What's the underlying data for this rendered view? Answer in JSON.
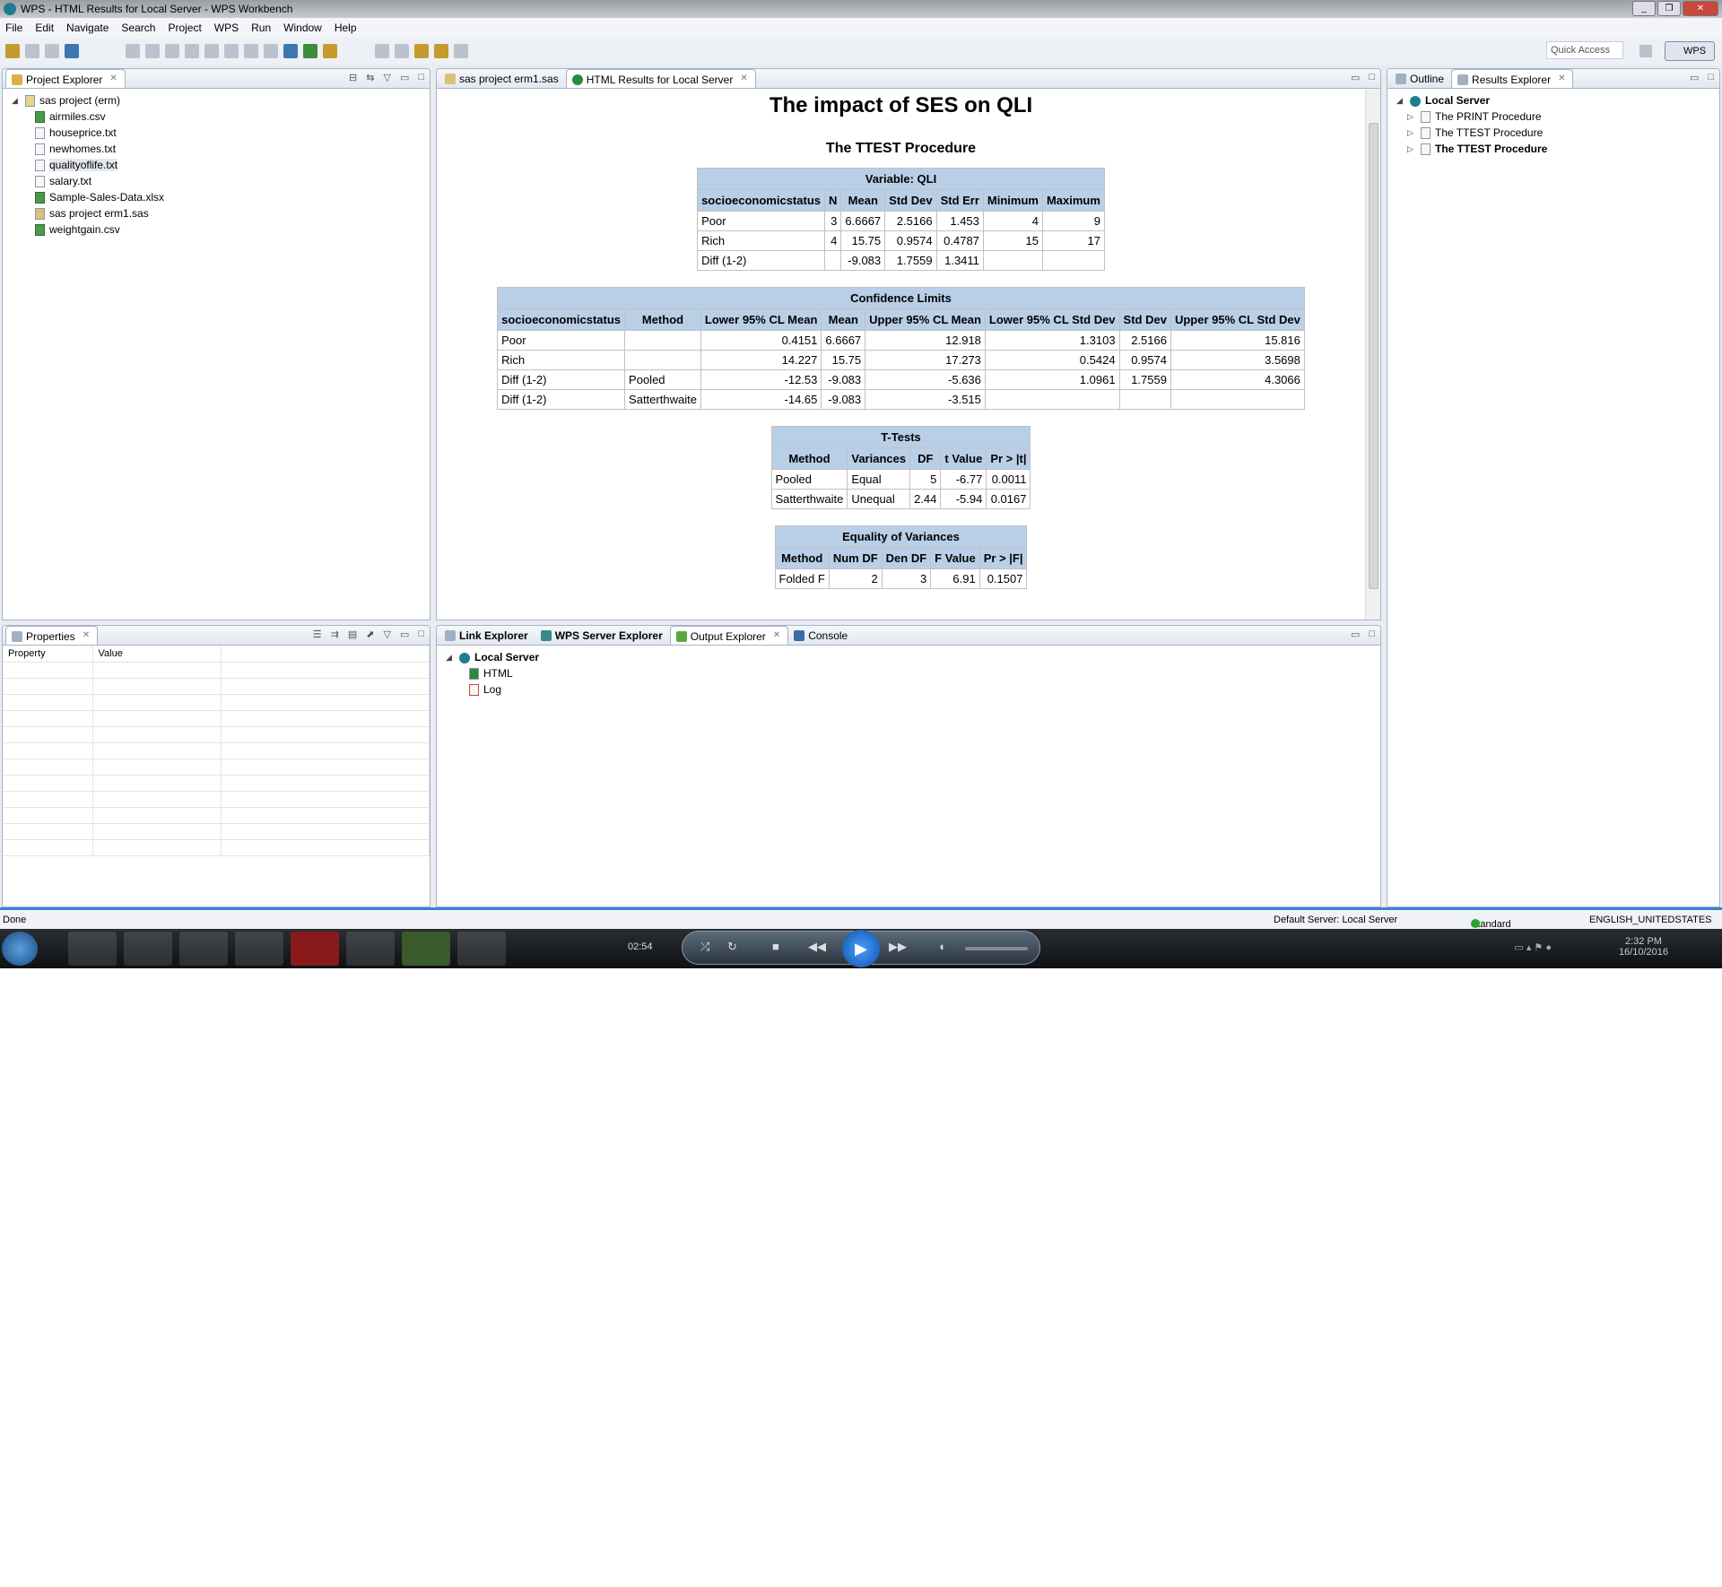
{
  "window": {
    "title": "WPS - HTML Results for Local Server - WPS Workbench"
  },
  "menu": [
    "File",
    "Edit",
    "Navigate",
    "Search",
    "Project",
    "WPS",
    "Run",
    "Window",
    "Help"
  ],
  "toolbar": {
    "quick_access": "Quick Access",
    "perspective": "WPS"
  },
  "project_explorer": {
    "tab": "Project Explorer",
    "project": "sas project (erm)",
    "files": [
      "airmiles.csv",
      "houseprice.txt",
      "newhomes.txt",
      "qualityoflife.txt",
      "salary.txt",
      "Sample-Sales-Data.xlsx",
      "sas project erm1.sas",
      "weightgain.csv"
    ]
  },
  "properties": {
    "tab": "Properties",
    "columns": [
      "Property",
      "Value"
    ]
  },
  "editor": {
    "tabs": [
      "sas project erm1.sas",
      "HTML Results for Local Server"
    ],
    "title": "The impact of SES on QLI",
    "procedure": "The TTEST Procedure",
    "tables": [
      {
        "caption": "Variable: QLI",
        "headers": [
          "socioeconomicstatus",
          "N",
          "Mean",
          "Std Dev",
          "Std Err",
          "Minimum",
          "Maximum"
        ],
        "rows": [
          [
            "Poor",
            "3",
            "6.6667",
            "2.5166",
            "1.453",
            "4",
            "9"
          ],
          [
            "Rich",
            "4",
            "15.75",
            "0.9574",
            "0.4787",
            "15",
            "17"
          ],
          [
            "Diff (1-2)",
            "",
            "-9.083",
            "1.7559",
            "1.3411",
            "",
            ""
          ]
        ]
      },
      {
        "caption": "Confidence Limits",
        "headers": [
          "socioeconomicstatus",
          "Method",
          "Lower 95% CL Mean",
          "Mean",
          "Upper 95% CL Mean",
          "Lower 95% CL Std Dev",
          "Std Dev",
          "Upper 95% CL Std Dev"
        ],
        "rows": [
          [
            "Poor",
            "",
            "0.4151",
            "6.6667",
            "12.918",
            "1.3103",
            "2.5166",
            "15.816"
          ],
          [
            "Rich",
            "",
            "14.227",
            "15.75",
            "17.273",
            "0.5424",
            "0.9574",
            "3.5698"
          ],
          [
            "Diff (1-2)",
            "Pooled",
            "-12.53",
            "-9.083",
            "-5.636",
            "1.0961",
            "1.7559",
            "4.3066"
          ],
          [
            "Diff (1-2)",
            "Satterthwaite",
            "-14.65",
            "-9.083",
            "-3.515",
            "",
            "",
            ""
          ]
        ]
      },
      {
        "caption": "T-Tests",
        "headers": [
          "Method",
          "Variances",
          "DF",
          "t Value",
          "Pr > |t|"
        ],
        "rows": [
          [
            "Pooled",
            "Equal",
            "5",
            "-6.77",
            "0.0011"
          ],
          [
            "Satterthwaite",
            "Unequal",
            "2.44",
            "-5.94",
            "0.0167"
          ]
        ]
      },
      {
        "caption": "Equality of Variances",
        "headers": [
          "Method",
          "Num DF",
          "Den DF",
          "F Value",
          "Pr > |F|"
        ],
        "rows": [
          [
            "Folded F",
            "2",
            "3",
            "6.91",
            "0.1507"
          ]
        ]
      }
    ]
  },
  "bottom": {
    "tabs": [
      "Link Explorer",
      "WPS Server Explorer",
      "Output Explorer",
      "Console"
    ],
    "server": "Local Server",
    "items": [
      "HTML",
      "Log"
    ]
  },
  "right": {
    "tabs": [
      "Outline",
      "Results Explorer"
    ],
    "server": "Local Server",
    "items": [
      "The PRINT Procedure",
      "The TTEST Procedure",
      "The TTEST Procedure"
    ]
  },
  "status": {
    "left": "Done",
    "server": "Default Server: Local Server",
    "licence": "Standard Licence",
    "locale": "ENGLISH_UNITEDSTATES"
  },
  "taskbar": {
    "media_time": "02:54",
    "clock": "2:32 PM",
    "date": "16/10/2016"
  }
}
